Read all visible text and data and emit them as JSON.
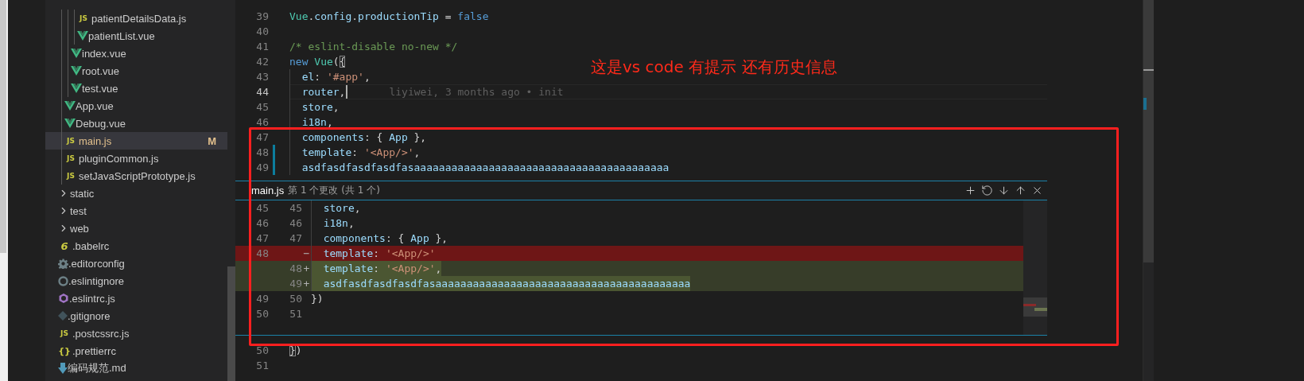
{
  "sidebar": {
    "tree": [
      {
        "children": [
          {
            "children": [
              {
                "children": [
                  {
                    "label": "patientDetailsData.js",
                    "kind": "js",
                    "glyph": "JS",
                    "selected": false
                  },
                  {
                    "label": "patientList.vue",
                    "kind": "vue",
                    "selected": false
                  }
                ]
              },
              {
                "label": "index.vue",
                "kind": "vue",
                "selected": false
              },
              {
                "label": "root.vue",
                "kind": "vue",
                "selected": false
              },
              {
                "label": "test.vue",
                "kind": "vue",
                "selected": false
              }
            ]
          },
          {
            "label": "App.vue",
            "kind": "vue",
            "selected": false
          },
          {
            "label": "Debug.vue",
            "kind": "vue",
            "selected": false
          },
          {
            "label": "main.js",
            "kind": "js",
            "glyph": "JS",
            "selected": true,
            "badge": "M"
          },
          {
            "label": "pluginCommon.js",
            "kind": "js",
            "glyph": "JS",
            "selected": false
          },
          {
            "label": "setJavaScriptPrototype.js",
            "kind": "js",
            "glyph": "JS",
            "selected": false
          }
        ]
      },
      {
        "label": "static",
        "kind": "folder",
        "expanded": false,
        "selected": false
      },
      {
        "label": "test",
        "kind": "folder",
        "expanded": false,
        "selected": false
      },
      {
        "label": "web",
        "kind": "folder",
        "expanded": false,
        "selected": false
      },
      {
        "label": ".babelrc",
        "kind": "babel",
        "glyph": "6",
        "selected": false
      },
      {
        "label": ".editorconfig",
        "kind": "config",
        "selected": false
      },
      {
        "label": ".eslintignore",
        "kind": "ignore",
        "selected": false
      },
      {
        "label": ".eslintrc.js",
        "kind": "eslint",
        "selected": false
      },
      {
        "label": ".gitignore",
        "kind": "git",
        "selected": false
      },
      {
        "label": ".postcssrc.js",
        "kind": "js",
        "glyph": "JS",
        "selected": false
      },
      {
        "label": ".prettierrc",
        "kind": "json",
        "glyph": "{}",
        "selected": false
      },
      {
        "label": "编码规范.md",
        "kind": "markdown",
        "selected": false
      }
    ]
  },
  "editor": {
    "lines_above": [
      {
        "number": "39",
        "tokens": [
          {
            "kind": "type",
            "text": "Vue"
          },
          {
            "kind": "plain",
            "text": "."
          },
          {
            "kind": "prop",
            "text": "config"
          },
          {
            "kind": "plain",
            "text": "."
          },
          {
            "kind": "prop",
            "text": "productionTip"
          },
          {
            "kind": "plain",
            "text": " = "
          },
          {
            "kind": "keyword",
            "text": "false"
          }
        ],
        "indented": false,
        "changed": false,
        "current": false
      },
      {
        "number": "40",
        "changed": false,
        "current": false
      },
      {
        "number": "41",
        "tokens": [
          {
            "kind": "comment",
            "text": "/* eslint-disable no-new */"
          }
        ],
        "indented": false,
        "changed": false,
        "current": false
      },
      {
        "number": "42",
        "tokens": [
          {
            "kind": "keyword",
            "text": "new "
          },
          {
            "kind": "type",
            "text": "Vue"
          },
          {
            "kind": "plain",
            "text": "("
          },
          {
            "kind": "bracket",
            "text": "{"
          }
        ],
        "indented": false,
        "changed": false,
        "current": false
      },
      {
        "number": "43",
        "tokens": [
          {
            "kind": "prop",
            "text": "el"
          },
          {
            "kind": "plain",
            "text": ": "
          },
          {
            "kind": "string",
            "text": "'#app'"
          },
          {
            "kind": "plain",
            "text": ","
          }
        ],
        "indented": true,
        "changed": false,
        "current": false
      },
      {
        "number": "44",
        "tokens": [
          {
            "kind": "prop",
            "text": "router"
          },
          {
            "kind": "plain",
            "text": ","
          }
        ],
        "indented": true,
        "changed": false,
        "current": true,
        "blame": "liyiwei, 3 months ago • init"
      },
      {
        "number": "45",
        "tokens": [
          {
            "kind": "prop",
            "text": "store"
          },
          {
            "kind": "plain",
            "text": ","
          }
        ],
        "indented": true,
        "changed": false,
        "current": false
      },
      {
        "number": "46",
        "tokens": [
          {
            "kind": "prop",
            "text": "i18n"
          },
          {
            "kind": "plain",
            "text": ","
          }
        ],
        "indented": true,
        "changed": false,
        "current": false
      },
      {
        "number": "47",
        "tokens": [
          {
            "kind": "prop",
            "text": "components"
          },
          {
            "kind": "plain",
            "text": ": { "
          },
          {
            "kind": "prop",
            "text": "App"
          },
          {
            "kind": "plain",
            "text": " },"
          }
        ],
        "indented": true,
        "changed": false,
        "current": false
      },
      {
        "number": "48",
        "tokens": [
          {
            "kind": "prop",
            "text": "template"
          },
          {
            "kind": "plain",
            "text": ": "
          },
          {
            "kind": "string",
            "text": "'<App/>'"
          },
          {
            "kind": "plain",
            "text": ","
          }
        ],
        "indented": true,
        "changed": true,
        "current": false
      },
      {
        "number": "49",
        "tokens": [
          {
            "kind": "prop",
            "text": "asdfasdfasdfasdfasaaaaaaaaaaaaaaaaaaaaaaaaaaaaaaaaaaaaaaaaa"
          }
        ],
        "indented": true,
        "changed": true,
        "current": false
      }
    ],
    "peek": {
      "file": "main.js",
      "summary": "第 1 个更改 (共 1 个)",
      "actions": [
        {
          "kind": "stage"
        },
        {
          "kind": "revert"
        },
        {
          "kind": "next"
        },
        {
          "kind": "previous"
        },
        {
          "kind": "close"
        }
      ],
      "rows": [
        {
          "kind": "context",
          "original": "45",
          "modified": "45",
          "indented": true,
          "tokens": [
            {
              "kind": "prop",
              "text": "store"
            },
            {
              "kind": "plain",
              "text": ","
            }
          ]
        },
        {
          "kind": "context",
          "original": "46",
          "modified": "46",
          "indented": true,
          "tokens": [
            {
              "kind": "prop",
              "text": "i18n"
            },
            {
              "kind": "plain",
              "text": ","
            }
          ]
        },
        {
          "kind": "context",
          "original": "47",
          "modified": "47",
          "indented": true,
          "tokens": [
            {
              "kind": "prop",
              "text": "components"
            },
            {
              "kind": "plain",
              "text": ": { "
            },
            {
              "kind": "prop",
              "text": "App"
            },
            {
              "kind": "plain",
              "text": " },"
            }
          ]
        },
        {
          "kind": "removed",
          "original": "48",
          "sign": "−",
          "indented": true,
          "tokens": [
            {
              "kind": "prop",
              "text": "template"
            },
            {
              "kind": "plain",
              "text": ": "
            },
            {
              "kind": "string",
              "text": "'<App/>'"
            }
          ]
        },
        {
          "kind": "added",
          "modified": "48",
          "sign": "+",
          "indented": true,
          "tokens": [
            {
              "kind": "prop",
              "text": "template"
            },
            {
              "kind": "plain",
              "text": ": "
            },
            {
              "kind": "string",
              "text": "'<App/>'"
            },
            {
              "kind": "plain",
              "text": ","
            }
          ]
        },
        {
          "kind": "added",
          "modified": "49",
          "sign": "+",
          "indented": true,
          "tokens": [
            {
              "kind": "prop",
              "text": "asdfasdfasdfasdfasaaaaaaaaaaaaaaaaaaaaaaaaaaaaaaaaaaaaaaaaa"
            }
          ]
        },
        {
          "kind": "context",
          "original": "49",
          "modified": "50",
          "indented": false,
          "tokens": [
            {
              "kind": "plain",
              "text": "})"
            }
          ]
        },
        {
          "kind": "context",
          "original": "50",
          "modified": "51"
        }
      ]
    },
    "lines_below": [
      {
        "number": "50",
        "tokens": [
          {
            "kind": "bracket",
            "text": "}"
          },
          {
            "kind": "plain",
            "text": ")"
          }
        ],
        "indented": false,
        "changed": false,
        "current": false
      },
      {
        "number": "51",
        "changed": false,
        "current": false
      }
    ]
  },
  "annotation": {
    "text": "这是vs code 有提示 还有历史信息"
  }
}
